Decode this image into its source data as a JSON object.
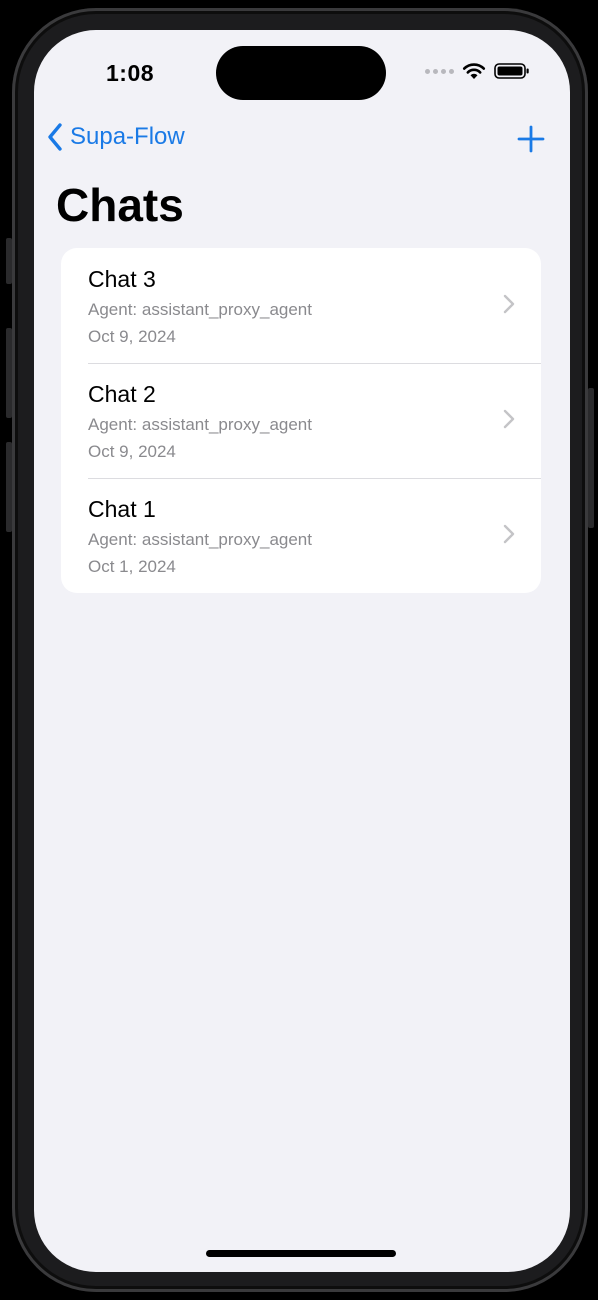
{
  "status_bar": {
    "time": "1:08"
  },
  "nav": {
    "back_label": "Supa-Flow",
    "back_icon": "chevron-left-icon",
    "add_icon": "plus-icon"
  },
  "page": {
    "title": "Chats"
  },
  "chats": [
    {
      "title": "Chat 3",
      "agent": "Agent: assistant_proxy_agent",
      "date": "Oct 9, 2024"
    },
    {
      "title": "Chat 2",
      "agent": "Agent: assistant_proxy_agent",
      "date": "Oct 9, 2024"
    },
    {
      "title": "Chat 1",
      "agent": "Agent: assistant_proxy_agent",
      "date": "Oct 1, 2024"
    }
  ],
  "colors": {
    "accent": "#1a7ae6",
    "background": "#f2f2f7",
    "secondary_text": "#8a8a8e"
  }
}
